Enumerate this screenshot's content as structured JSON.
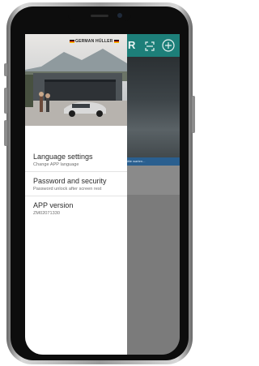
{
  "app": {
    "brand": "GERMAN HÜLLER",
    "background_letter": "R",
    "background_bar_text": "Bitte warten..."
  },
  "drawer": {
    "items": [
      {
        "title": "Language settings",
        "subtitle": "Change APP language"
      },
      {
        "title": "Password and security",
        "subtitle": "Password unlock after screen rest"
      }
    ],
    "version": {
      "title": "APP version",
      "value": "ZM02071330"
    }
  },
  "icons": {
    "scan": "scan-icon",
    "add": "plus-circle-icon"
  },
  "colors": {
    "header": "#1d7f79",
    "overlay": "#7b7b7b",
    "drawer_bg": "#ffffff"
  }
}
